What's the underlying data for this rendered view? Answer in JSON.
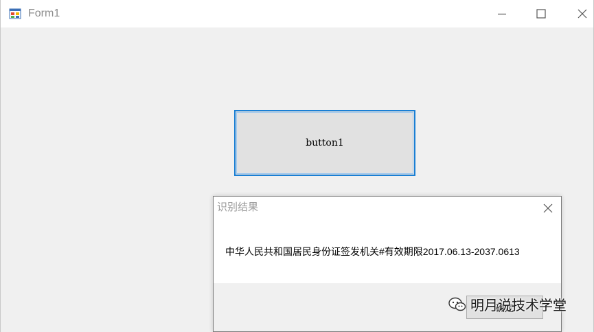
{
  "window": {
    "title": "Form1",
    "controls": {
      "minimize_icon": "minimize-icon",
      "maximize_icon": "maximize-icon",
      "close_icon": "close-icon"
    }
  },
  "form": {
    "button1_label": "button1"
  },
  "message_box": {
    "title": "识别结果",
    "text": "中华人民共和国居民身份证签发机关#有效期限2017.06.13-2037.0613",
    "ok_label": "确定"
  },
  "watermark": {
    "text": "明月说技术学堂",
    "icon": "wechat-icon"
  },
  "colors": {
    "accent": "#1a7fd4",
    "window_bg": "#f0f0f0",
    "button_bg": "#e1e1e1"
  }
}
